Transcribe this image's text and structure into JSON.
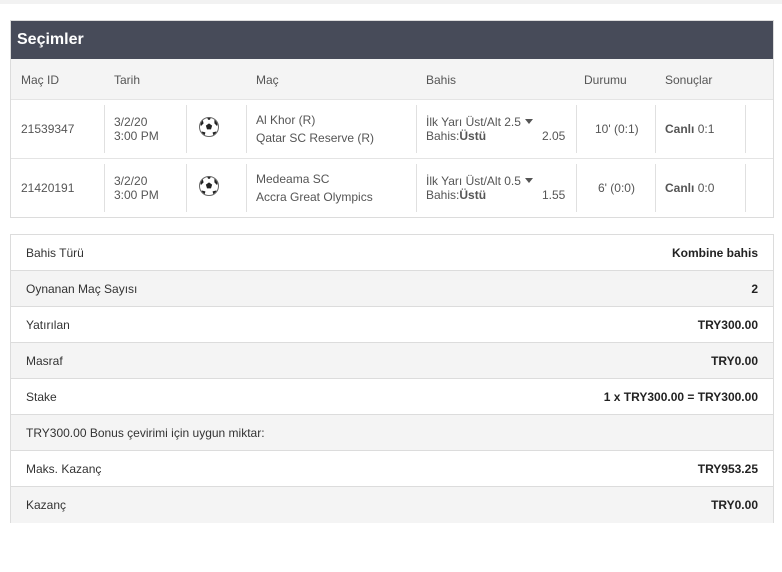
{
  "panel": {
    "title": "Seçimler"
  },
  "columns": [
    "Maç ID",
    "Tarih",
    "Maç",
    "Bahis",
    "Durumu",
    "Sonuçlar"
  ],
  "matches": [
    {
      "id": "21539347",
      "date": "3/2/20",
      "time": "3:00 PM",
      "home": "Al Khor (R)",
      "away": "Qatar SC Reserve (R)",
      "market": "İlk Yarı Üst/Alt 2.5",
      "bet_prefix": "Bahis:",
      "bet_value": "Üstü",
      "odds": "2.05",
      "status": "10' (0:1)",
      "result_label": "Canlı",
      "result_score": "0:1"
    },
    {
      "id": "21420191",
      "date": "3/2/20",
      "time": "3:00 PM",
      "home": "Medeama SC",
      "away": "Accra Great Olympics",
      "market": "İlk Yarı Üst/Alt 0.5",
      "bet_prefix": "Bahis:",
      "bet_value": "Üstü",
      "odds": "1.55",
      "status": "6' (0:0)",
      "result_label": "Canlı",
      "result_score": "0:0"
    }
  ],
  "summary": [
    {
      "label": "Bahis Türü",
      "value": "Kombine bahis"
    },
    {
      "label": "Oynanan Maç Sayısı",
      "value": "2"
    },
    {
      "label": "Yatırılan",
      "value": "TRY300.00"
    },
    {
      "label": "Masraf",
      "value": "TRY0.00"
    },
    {
      "label": "Stake",
      "value": "1 x TRY300.00 = TRY300.00"
    },
    {
      "label": "TRY300.00 Bonus çevirimi için uygun miktar:",
      "value": ""
    },
    {
      "label": "Maks. Kazanç",
      "value": "TRY953.25"
    },
    {
      "label": "Kazanç",
      "value": "TRY0.00"
    }
  ],
  "icons": {
    "sport": "soccer-ball-icon",
    "dropdown": "caret-down-icon"
  }
}
